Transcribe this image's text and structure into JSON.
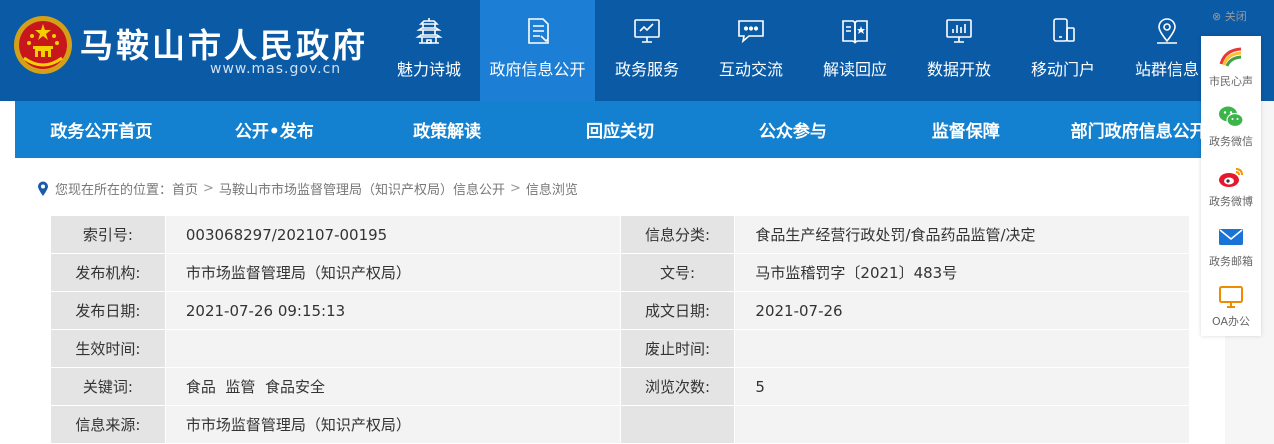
{
  "header": {
    "site_title": "马鞍山市人民政府",
    "site_domain": "www.mas.gov.cn",
    "close_label": "关闭",
    "nav": [
      {
        "label": "魅力诗城",
        "icon": "pagoda-icon"
      },
      {
        "label": "政府信息公开",
        "icon": "document-icon",
        "active": true
      },
      {
        "label": "政务服务",
        "icon": "monitor-icon"
      },
      {
        "label": "互动交流",
        "icon": "chat-icon"
      },
      {
        "label": "解读回应",
        "icon": "book-icon"
      },
      {
        "label": "数据开放",
        "icon": "data-chart-icon"
      },
      {
        "label": "移动门户",
        "icon": "mobile-icon"
      },
      {
        "label": "站群信息",
        "icon": "location-pin-icon"
      }
    ]
  },
  "float_bar": [
    {
      "label": "市民心声",
      "icon": "rainbow-logo-icon"
    },
    {
      "label": "政务微信",
      "icon": "wechat-icon"
    },
    {
      "label": "政务微博",
      "icon": "weibo-icon"
    },
    {
      "label": "政务邮箱",
      "icon": "mail-icon"
    },
    {
      "label": "OA办公",
      "icon": "oa-monitor-icon"
    }
  ],
  "subnav": [
    "政务公开首页",
    "公开•发布",
    "政策解读",
    "回应关切",
    "公众参与",
    "监督保障",
    "部门政府信息公开"
  ],
  "breadcrumb": {
    "prefix": "您现在所在的位置：",
    "items": [
      "首页",
      "马鞍山市市场监督管理局（知识产权局）信息公开",
      "信息浏览"
    ]
  },
  "info": [
    {
      "k1": "索引号:",
      "v1": "003068297/202107-00195",
      "k2": "信息分类:",
      "v2": "食品生产经营行政处罚/食品药品监管/决定"
    },
    {
      "k1": "发布机构:",
      "v1": "市市场监督管理局（知识产权局）",
      "k2": "文号:",
      "v2": "马市监稽罚字〔2021〕483号"
    },
    {
      "k1": "发布日期:",
      "v1": "2021-07-26 09:15:13",
      "k2": "成文日期:",
      "v2": "2021-07-26"
    },
    {
      "k1": "生效时间:",
      "v1": "",
      "k2": "废止时间:",
      "v2": ""
    },
    {
      "k1": "关键词:",
      "v1": "食品  监管  食品安全",
      "k2": "浏览次数:",
      "v2": "5"
    },
    {
      "k1": "信息来源:",
      "v1": "市市场监督管理局（知识产权局）",
      "k2": "",
      "v2": ""
    }
  ]
}
